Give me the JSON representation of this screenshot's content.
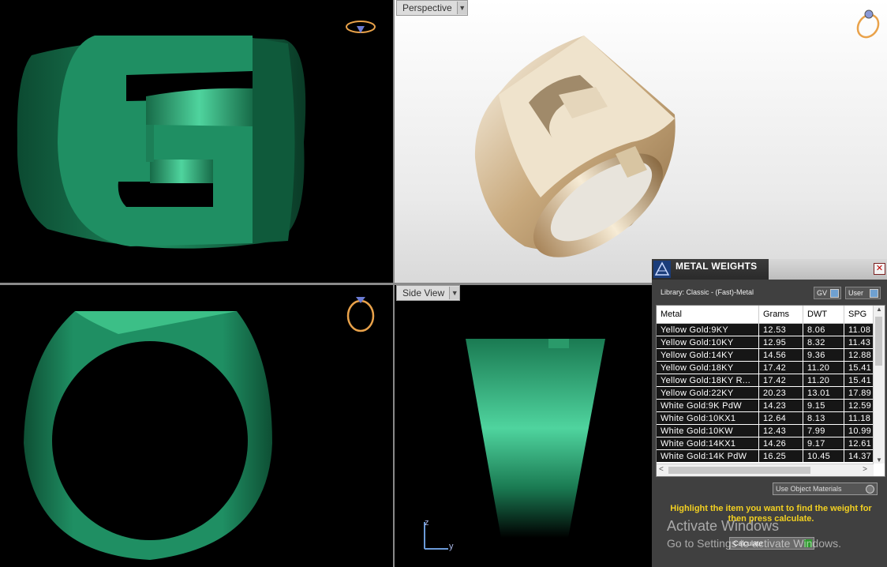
{
  "viewports": {
    "perspective_label": "Perspective",
    "side_view_label": "Side View"
  },
  "axis": {
    "z_label": "z",
    "y_label": "y"
  },
  "colors": {
    "ring_green": "#1f8f63",
    "ring_gold": "#d9c39a",
    "gizmo_orange": "#e9a24a",
    "panel_bg": "#404040",
    "hint_yellow": "#f2d021"
  },
  "metal_weights": {
    "title": "METAL WEIGHTS",
    "close_icon": "close-icon",
    "library": "Library: Classic - (Fast)-Metal",
    "gv_label": "GV",
    "user_label": "User",
    "columns": [
      "Metal",
      "Grams",
      "DWT",
      "SPG"
    ],
    "rows": [
      [
        "Yellow Gold:9KY",
        "12.53",
        "8.06",
        "11.08"
      ],
      [
        "Yellow Gold:10KY",
        "12.95",
        "8.32",
        "11.43"
      ],
      [
        "Yellow Gold:14KY",
        "14.56",
        "9.36",
        "12.88"
      ],
      [
        "Yellow Gold:18KY",
        "17.42",
        "11.20",
        "15.41"
      ],
      [
        "Yellow Gold:18KY R...",
        "17.42",
        "11.20",
        "15.41"
      ],
      [
        "Yellow Gold:22KY",
        "20.23",
        "13.01",
        "17.89"
      ],
      [
        "White Gold:9K PdW",
        "14.23",
        "9.15",
        "12.59"
      ],
      [
        "White Gold:10KX1",
        "12.64",
        "8.13",
        "11.18"
      ],
      [
        "White Gold:10KW",
        "12.43",
        "7.99",
        "10.99"
      ],
      [
        "White Gold:14KX1",
        "14.26",
        "9.17",
        "12.61"
      ],
      [
        "White Gold:14K PdW",
        "16.25",
        "10.45",
        "14.37"
      ]
    ],
    "use_object_materials": "Use Object Materials",
    "hint": "Highlight the item you want to find the weight for then press calculate.",
    "calculate_label": "Calculate"
  },
  "watermark": {
    "line1": "Activate Windows",
    "line2": "Go to Settings to activate Windows."
  }
}
